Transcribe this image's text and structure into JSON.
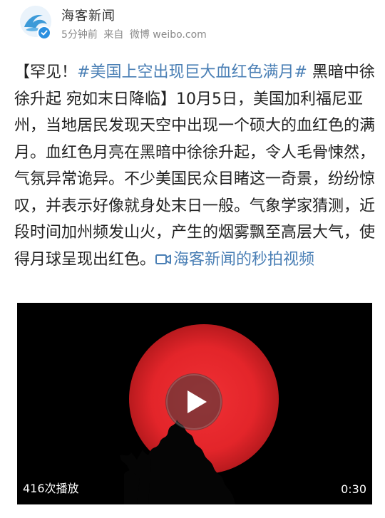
{
  "post": {
    "author": "海客新闻",
    "time": "5分钟前",
    "source_prefix": "来自",
    "source": "微博 weibo.com",
    "text_prefix": "【罕见！",
    "topic": "#美国上空出现巨大血红色满月#",
    "text_body": " 黑暗中徐徐升起 宛如末日降临】10月5日，美国加利福尼亚州，当地居民发现天空中出现一个硕大的血红色的满月。血红色月亮在黑暗中徐徐升起，令人毛骨悚然，气氛异常诡异。不少美国民众目睹这一奇景，纷纷惊叹，并表示好像就身处末日一般。气象学家猜测，近段时间加州频发山火，产生的烟雾飘至高层大气，使得月球呈现出红色。",
    "video_link": "海客新闻的秒拍视频"
  },
  "video": {
    "play_count": "416次播放",
    "duration": "0:30",
    "moon_color": "#e8262b"
  },
  "colors": {
    "link": "#4a7fb5",
    "verified_badge": "#2a8fe0"
  },
  "icons": {
    "avatar": "wave-logo-icon",
    "verified": "verified-check-icon",
    "video_link": "video-camera-icon",
    "play": "play-icon"
  }
}
